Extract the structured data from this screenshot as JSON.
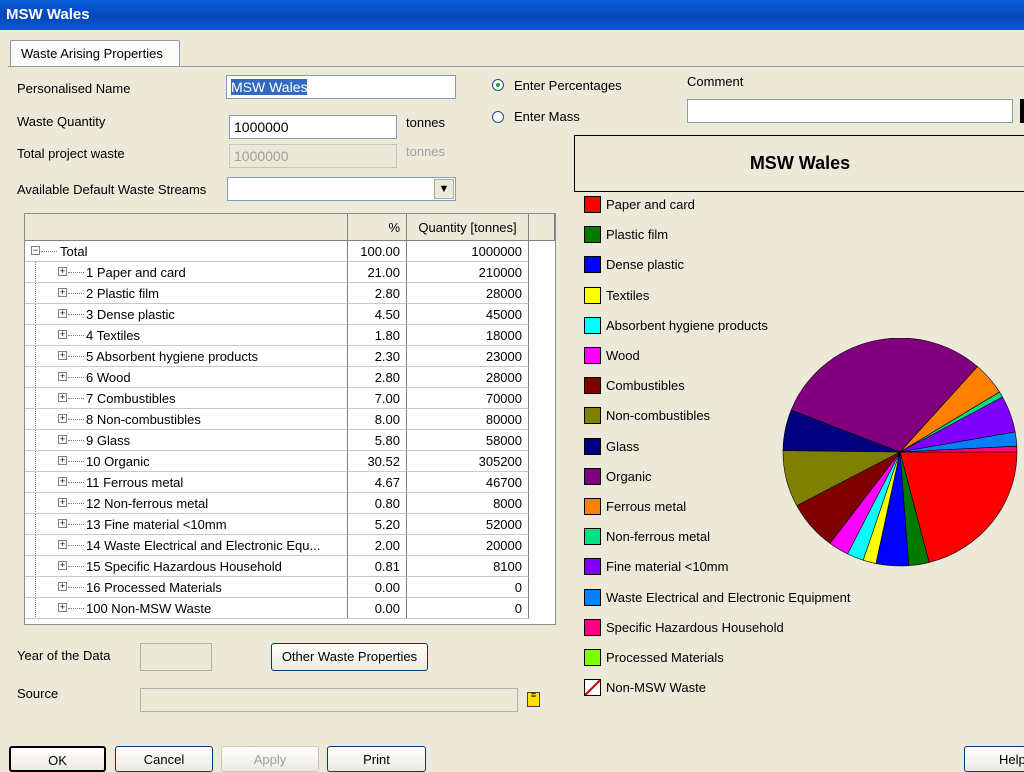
{
  "window": {
    "title": "MSW Wales"
  },
  "tab": {
    "label": "Waste Arising Properties"
  },
  "form": {
    "name_label": "Personalised Name",
    "name_value": "MSW Wales",
    "quantity_label": "Waste Quantity",
    "quantity_value": "1000000",
    "quantity_unit": "tonnes",
    "total_label": "Total project waste",
    "total_value": "1000000",
    "total_unit": "tonnes",
    "streams_label": "Available Default Waste Streams",
    "streams_value": "",
    "mode_percent": "Enter Percentages",
    "mode_mass": "Enter Mass",
    "comment_label": "Comment",
    "comment_value": "",
    "year_label": "Year of the Data",
    "year_value": "",
    "other_button": "Other Waste Properties",
    "source_label": "Source",
    "source_value": ""
  },
  "grid": {
    "col_pct": "%",
    "col_qty": "Quantity [tonnes]",
    "rows": [
      {
        "name": "Total",
        "pct": "100.00",
        "qty": "1000000"
      },
      {
        "name": "1 Paper and card",
        "pct": "21.00",
        "qty": "210000"
      },
      {
        "name": "2 Plastic film",
        "pct": "2.80",
        "qty": "28000"
      },
      {
        "name": "3 Dense plastic",
        "pct": "4.50",
        "qty": "45000"
      },
      {
        "name": "4 Textiles",
        "pct": "1.80",
        "qty": "18000"
      },
      {
        "name": "5 Absorbent hygiene products",
        "pct": "2.30",
        "qty": "23000"
      },
      {
        "name": "6 Wood",
        "pct": "2.80",
        "qty": "28000"
      },
      {
        "name": "7 Combustibles",
        "pct": "7.00",
        "qty": "70000"
      },
      {
        "name": "8 Non-combustibles",
        "pct": "8.00",
        "qty": "80000"
      },
      {
        "name": "9 Glass",
        "pct": "5.80",
        "qty": "58000"
      },
      {
        "name": "10 Organic",
        "pct": "30.52",
        "qty": "305200"
      },
      {
        "name": "11 Ferrous metal",
        "pct": "4.67",
        "qty": "46700"
      },
      {
        "name": "12 Non-ferrous metal",
        "pct": "0.80",
        "qty": "8000"
      },
      {
        "name": "13 Fine material <10mm",
        "pct": "5.20",
        "qty": "52000"
      },
      {
        "name": "14 Waste Electrical and Electronic Equ...",
        "pct": "2.00",
        "qty": "20000"
      },
      {
        "name": "15 Specific Hazardous Household",
        "pct": "0.81",
        "qty": "8100"
      },
      {
        "name": "16 Processed Materials",
        "pct": "0.00",
        "qty": "0"
      },
      {
        "name": "100 Non-MSW Waste",
        "pct": "0.00",
        "qty": "0"
      }
    ]
  },
  "buttons": {
    "ok": "OK",
    "cancel": "Cancel",
    "apply": "Apply",
    "print": "Print",
    "help": "Help"
  },
  "chart_data": {
    "type": "pie",
    "title": "MSW Wales",
    "legend": [
      {
        "name": "Paper and card",
        "value": 21.0,
        "color": "#ff0000"
      },
      {
        "name": "Plastic film",
        "value": 2.8,
        "color": "#007a00"
      },
      {
        "name": "Dense plastic",
        "value": 4.5,
        "color": "#0000ff"
      },
      {
        "name": "Textiles",
        "value": 1.8,
        "color": "#ffff00"
      },
      {
        "name": "Absorbent hygiene products",
        "value": 2.3,
        "color": "#00ffff"
      },
      {
        "name": "Wood",
        "value": 2.8,
        "color": "#ff00ff"
      },
      {
        "name": "Combustibles",
        "value": 7.0,
        "color": "#800000"
      },
      {
        "name": "Non-combustibles",
        "value": 8.0,
        "color": "#808000"
      },
      {
        "name": "Glass",
        "value": 5.8,
        "color": "#000080"
      },
      {
        "name": "Organic",
        "value": 30.52,
        "color": "#800080"
      },
      {
        "name": "Ferrous metal",
        "value": 4.67,
        "color": "#ff8000"
      },
      {
        "name": "Non-ferrous metal",
        "value": 0.8,
        "color": "#00e080"
      },
      {
        "name": "Fine material <10mm",
        "value": 5.2,
        "color": "#8000ff"
      },
      {
        "name": "Waste Electrical and Electronic Equipment",
        "value": 2.0,
        "color": "#0080ff"
      },
      {
        "name": "Specific Hazardous Household",
        "value": 0.81,
        "color": "#ff0080"
      },
      {
        "name": "Processed Materials",
        "value": 0.0,
        "color": "#80ff00"
      },
      {
        "name": "Non-MSW Waste",
        "value": 0.0,
        "color": "#ffffff"
      }
    ]
  }
}
